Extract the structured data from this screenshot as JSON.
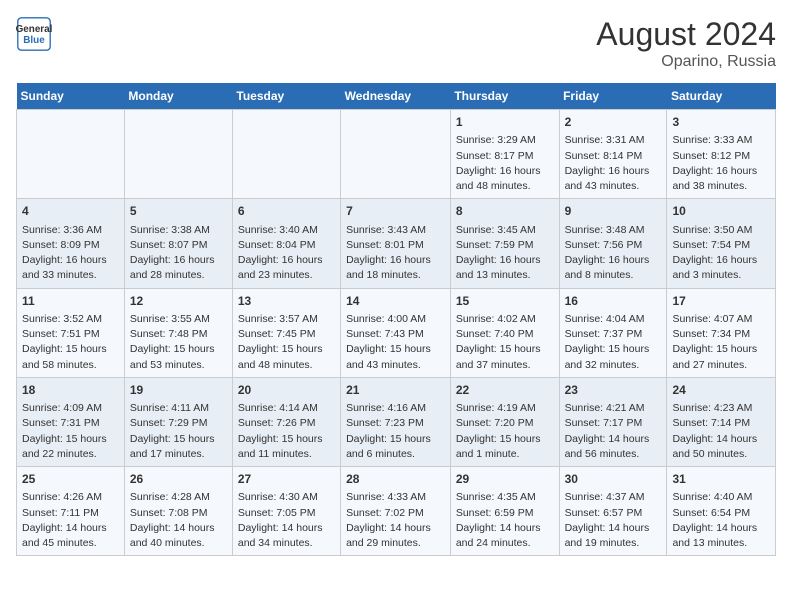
{
  "header": {
    "title": "August 2024",
    "subtitle": "Oparino, Russia",
    "logo_line1": "General",
    "logo_line2": "Blue"
  },
  "days_of_week": [
    "Sunday",
    "Monday",
    "Tuesday",
    "Wednesday",
    "Thursday",
    "Friday",
    "Saturday"
  ],
  "weeks": [
    [
      {
        "day": "",
        "content": ""
      },
      {
        "day": "",
        "content": ""
      },
      {
        "day": "",
        "content": ""
      },
      {
        "day": "",
        "content": ""
      },
      {
        "day": "1",
        "content": "Sunrise: 3:29 AM\nSunset: 8:17 PM\nDaylight: 16 hours\nand 48 minutes."
      },
      {
        "day": "2",
        "content": "Sunrise: 3:31 AM\nSunset: 8:14 PM\nDaylight: 16 hours\nand 43 minutes."
      },
      {
        "day": "3",
        "content": "Sunrise: 3:33 AM\nSunset: 8:12 PM\nDaylight: 16 hours\nand 38 minutes."
      }
    ],
    [
      {
        "day": "4",
        "content": "Sunrise: 3:36 AM\nSunset: 8:09 PM\nDaylight: 16 hours\nand 33 minutes."
      },
      {
        "day": "5",
        "content": "Sunrise: 3:38 AM\nSunset: 8:07 PM\nDaylight: 16 hours\nand 28 minutes."
      },
      {
        "day": "6",
        "content": "Sunrise: 3:40 AM\nSunset: 8:04 PM\nDaylight: 16 hours\nand 23 minutes."
      },
      {
        "day": "7",
        "content": "Sunrise: 3:43 AM\nSunset: 8:01 PM\nDaylight: 16 hours\nand 18 minutes."
      },
      {
        "day": "8",
        "content": "Sunrise: 3:45 AM\nSunset: 7:59 PM\nDaylight: 16 hours\nand 13 minutes."
      },
      {
        "day": "9",
        "content": "Sunrise: 3:48 AM\nSunset: 7:56 PM\nDaylight: 16 hours\nand 8 minutes."
      },
      {
        "day": "10",
        "content": "Sunrise: 3:50 AM\nSunset: 7:54 PM\nDaylight: 16 hours\nand 3 minutes."
      }
    ],
    [
      {
        "day": "11",
        "content": "Sunrise: 3:52 AM\nSunset: 7:51 PM\nDaylight: 15 hours\nand 58 minutes."
      },
      {
        "day": "12",
        "content": "Sunrise: 3:55 AM\nSunset: 7:48 PM\nDaylight: 15 hours\nand 53 minutes."
      },
      {
        "day": "13",
        "content": "Sunrise: 3:57 AM\nSunset: 7:45 PM\nDaylight: 15 hours\nand 48 minutes."
      },
      {
        "day": "14",
        "content": "Sunrise: 4:00 AM\nSunset: 7:43 PM\nDaylight: 15 hours\nand 43 minutes."
      },
      {
        "day": "15",
        "content": "Sunrise: 4:02 AM\nSunset: 7:40 PM\nDaylight: 15 hours\nand 37 minutes."
      },
      {
        "day": "16",
        "content": "Sunrise: 4:04 AM\nSunset: 7:37 PM\nDaylight: 15 hours\nand 32 minutes."
      },
      {
        "day": "17",
        "content": "Sunrise: 4:07 AM\nSunset: 7:34 PM\nDaylight: 15 hours\nand 27 minutes."
      }
    ],
    [
      {
        "day": "18",
        "content": "Sunrise: 4:09 AM\nSunset: 7:31 PM\nDaylight: 15 hours\nand 22 minutes."
      },
      {
        "day": "19",
        "content": "Sunrise: 4:11 AM\nSunset: 7:29 PM\nDaylight: 15 hours\nand 17 minutes."
      },
      {
        "day": "20",
        "content": "Sunrise: 4:14 AM\nSunset: 7:26 PM\nDaylight: 15 hours\nand 11 minutes."
      },
      {
        "day": "21",
        "content": "Sunrise: 4:16 AM\nSunset: 7:23 PM\nDaylight: 15 hours\nand 6 minutes."
      },
      {
        "day": "22",
        "content": "Sunrise: 4:19 AM\nSunset: 7:20 PM\nDaylight: 15 hours\nand 1 minute."
      },
      {
        "day": "23",
        "content": "Sunrise: 4:21 AM\nSunset: 7:17 PM\nDaylight: 14 hours\nand 56 minutes."
      },
      {
        "day": "24",
        "content": "Sunrise: 4:23 AM\nSunset: 7:14 PM\nDaylight: 14 hours\nand 50 minutes."
      }
    ],
    [
      {
        "day": "25",
        "content": "Sunrise: 4:26 AM\nSunset: 7:11 PM\nDaylight: 14 hours\nand 45 minutes."
      },
      {
        "day": "26",
        "content": "Sunrise: 4:28 AM\nSunset: 7:08 PM\nDaylight: 14 hours\nand 40 minutes."
      },
      {
        "day": "27",
        "content": "Sunrise: 4:30 AM\nSunset: 7:05 PM\nDaylight: 14 hours\nand 34 minutes."
      },
      {
        "day": "28",
        "content": "Sunrise: 4:33 AM\nSunset: 7:02 PM\nDaylight: 14 hours\nand 29 minutes."
      },
      {
        "day": "29",
        "content": "Sunrise: 4:35 AM\nSunset: 6:59 PM\nDaylight: 14 hours\nand 24 minutes."
      },
      {
        "day": "30",
        "content": "Sunrise: 4:37 AM\nSunset: 6:57 PM\nDaylight: 14 hours\nand 19 minutes."
      },
      {
        "day": "31",
        "content": "Sunrise: 4:40 AM\nSunset: 6:54 PM\nDaylight: 14 hours\nand 13 minutes."
      }
    ]
  ]
}
